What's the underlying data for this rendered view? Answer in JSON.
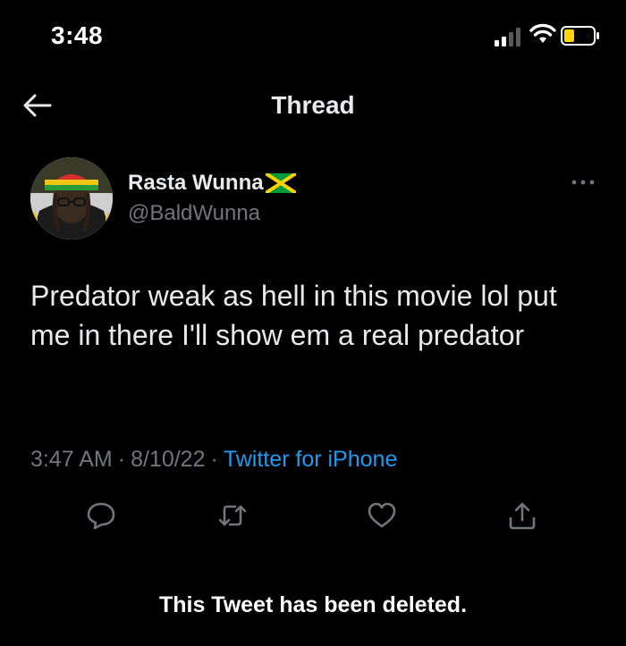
{
  "status_bar": {
    "time": "3:48",
    "icons": [
      "signal-icon",
      "wifi-icon",
      "battery-icon"
    ]
  },
  "nav": {
    "title": "Thread",
    "back_icon": "back-arrow-icon"
  },
  "tweet": {
    "author": {
      "display_name": "Rasta Wunna",
      "flag_emoji": "jamaica-flag-emoji",
      "handle": "@BaldWunna"
    },
    "text": "Predator weak as hell in this movie lol put me in there I'll show em a real predator",
    "time": "3:47 AM",
    "date": "8/10/22",
    "separator": "·",
    "source": "Twitter for iPhone",
    "actions": [
      "reply-icon",
      "retweet-icon",
      "like-icon",
      "share-icon"
    ]
  },
  "notice": "This Tweet has been deleted.",
  "colors": {
    "background": "#000000",
    "text": "#e7e9ea",
    "secondary_text": "#71767b",
    "link": "#1d9bf0"
  }
}
